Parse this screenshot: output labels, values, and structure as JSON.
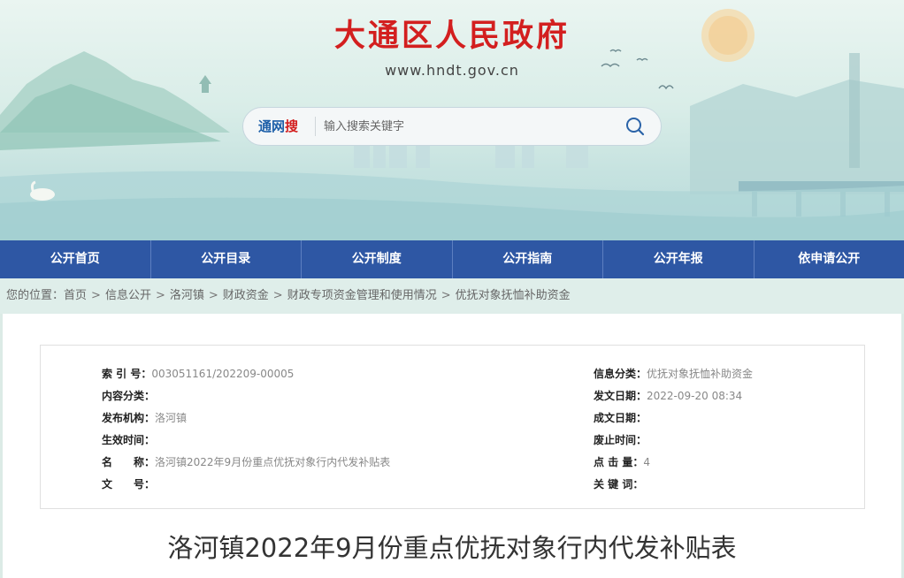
{
  "site": {
    "title": "大通区人民政府",
    "url": "www.hndt.gov.cn"
  },
  "search": {
    "brand_part1": "通网",
    "brand_part2": "搜",
    "placeholder": "输入搜索关键字"
  },
  "nav": {
    "items": [
      "公开首页",
      "公开目录",
      "公开制度",
      "公开指南",
      "公开年报",
      "依申请公开"
    ]
  },
  "breadcrumb": {
    "prefix": "您的位置：",
    "items": [
      "首页",
      "信息公开",
      "洛河镇",
      "财政资金",
      "财政专项资金管理和使用情况",
      "优抚对象抚恤补助资金"
    ],
    "separator": ">"
  },
  "meta": {
    "left": [
      {
        "label": "索 引 号：",
        "value": "003051161/202209-00005"
      },
      {
        "label": "内容分类：",
        "value": ""
      },
      {
        "label": "发布机构：",
        "value": "洛河镇"
      },
      {
        "label": "生效时间：",
        "value": ""
      },
      {
        "label": "名　　称：",
        "value": "洛河镇2022年9月份重点优抚对象行内代发补贴表"
      },
      {
        "label": "文　　号：",
        "value": ""
      }
    ],
    "right": [
      {
        "label": "信息分类：",
        "value": "优抚对象抚恤补助资金"
      },
      {
        "label": "发文日期：",
        "value": "2022-09-20 08:34"
      },
      {
        "label": "成文日期：",
        "value": ""
      },
      {
        "label": "废止时间：",
        "value": ""
      },
      {
        "label": "点 击 量：",
        "value": "4"
      },
      {
        "label": "关 键 词：",
        "value": ""
      }
    ]
  },
  "document": {
    "title": "洛河镇2022年9月份重点优抚对象行内代发补贴表"
  },
  "colors": {
    "title_red": "#d31f1f",
    "nav_blue": "#2e57a4",
    "brand_blue": "#1b5ea8"
  }
}
